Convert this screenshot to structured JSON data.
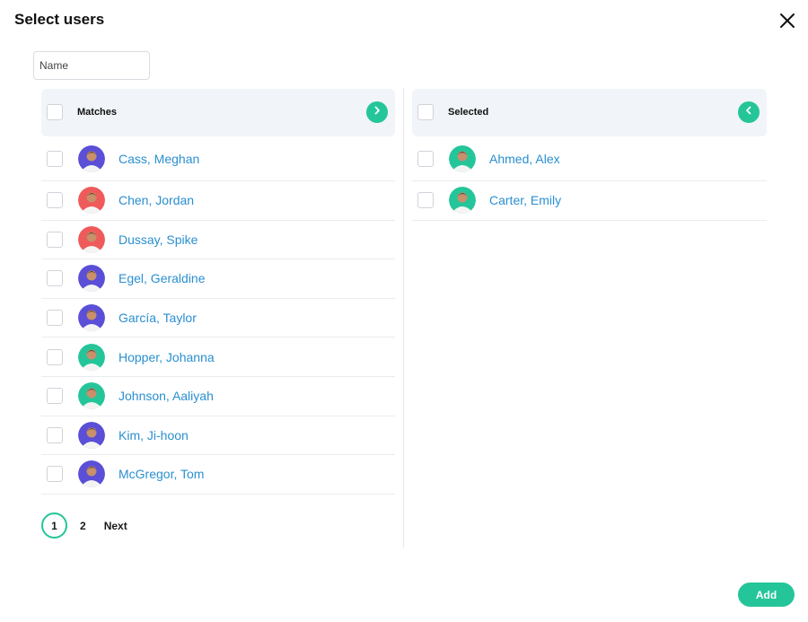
{
  "dialog": {
    "title": "Select users",
    "close_icon": "close-icon"
  },
  "filter": {
    "placeholder": "Name",
    "value": ""
  },
  "matches": {
    "header": "Matches",
    "move_icon": "chevron-right-icon",
    "users": [
      {
        "name": "Cass, Meghan",
        "avatar_bg": "#5a4fd6"
      },
      {
        "name": "Chen, Jordan",
        "avatar_bg": "#ef5a5a"
      },
      {
        "name": "Dussay, Spike",
        "avatar_bg": "#ef5a5a"
      },
      {
        "name": "Egel, Geraldine",
        "avatar_bg": "#5a4fd6"
      },
      {
        "name": "García, Taylor",
        "avatar_bg": "#5a4fd6"
      },
      {
        "name": "Hopper, Johanna",
        "avatar_bg": "#25c59a"
      },
      {
        "name": "Johnson, Aaliyah",
        "avatar_bg": "#25c59a"
      },
      {
        "name": "Kim, Ji-hoon",
        "avatar_bg": "#5a4fd6"
      },
      {
        "name": "McGregor, Tom",
        "avatar_bg": "#5a4fd6"
      }
    ]
  },
  "selected": {
    "header": "Selected",
    "move_icon": "chevron-left-icon",
    "users": [
      {
        "name": "Ahmed, Alex",
        "avatar_bg": "#25c59a"
      },
      {
        "name": "Carter, Emily",
        "avatar_bg": "#25c59a"
      }
    ]
  },
  "pagination": {
    "current": "1",
    "pages": [
      "2"
    ],
    "next": "Next"
  },
  "actions": {
    "add": "Add"
  },
  "colors": {
    "accent": "#25c59a",
    "link": "#2a8fd0"
  }
}
